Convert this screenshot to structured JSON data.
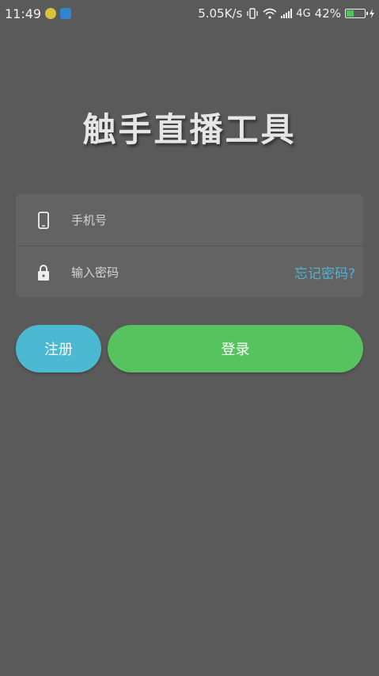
{
  "status_bar": {
    "time": "11:49",
    "net_speed": "5.05K/s",
    "network_type": "4G",
    "battery_percent": "42%",
    "battery_level": 0.42
  },
  "app": {
    "title": "触手直播工具"
  },
  "form": {
    "phone_placeholder": "手机号",
    "phone_value": "",
    "password_placeholder": "输入密码",
    "password_value": "",
    "forgot_label": "忘记密码?"
  },
  "buttons": {
    "register_label": "注册",
    "login_label": "登录"
  },
  "colors": {
    "background": "#5a5a5a",
    "card": "#636363",
    "accent_blue": "#4cb8d2",
    "accent_green": "#56c35f",
    "link": "#4db3d4"
  },
  "icons": {
    "phone": "smartphone-icon",
    "password": "lock-icon"
  }
}
